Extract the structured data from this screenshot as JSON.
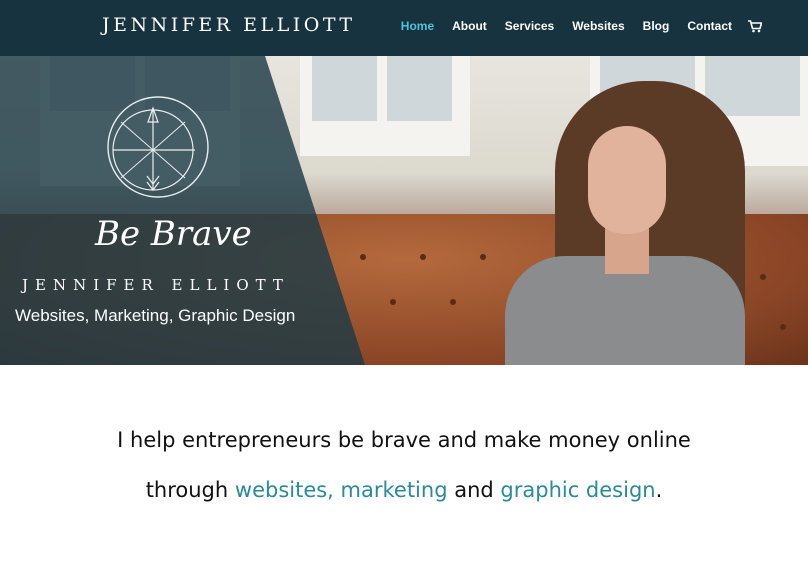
{
  "header": {
    "logo": "JENNIFER ELLIOTT",
    "nav": [
      {
        "label": "Home",
        "active": true
      },
      {
        "label": "About",
        "active": false
      },
      {
        "label": "Services",
        "active": false
      },
      {
        "label": "Websites",
        "active": false
      },
      {
        "label": "Blog",
        "active": false
      },
      {
        "label": "Contact",
        "active": false
      }
    ],
    "cart_icon": "shopping-cart-icon"
  },
  "hero": {
    "emblem_icon": "compass-arrow-icon",
    "tagline": "Be Brave",
    "name": "JENNIFER ELLIOTT",
    "subtitle": "Websites, Marketing, Graphic Design"
  },
  "intro": {
    "line1": "I help entrepreneurs be brave and make money online",
    "line2_pre": "through ",
    "line2_hl1": "websites, marketing",
    "line2_mid": " and ",
    "line2_hl2": "graphic design",
    "line2_post": "."
  },
  "colors": {
    "header_bg": "#16333f",
    "nav_active": "#4fc3d9",
    "highlight": "#2a8a9a"
  }
}
